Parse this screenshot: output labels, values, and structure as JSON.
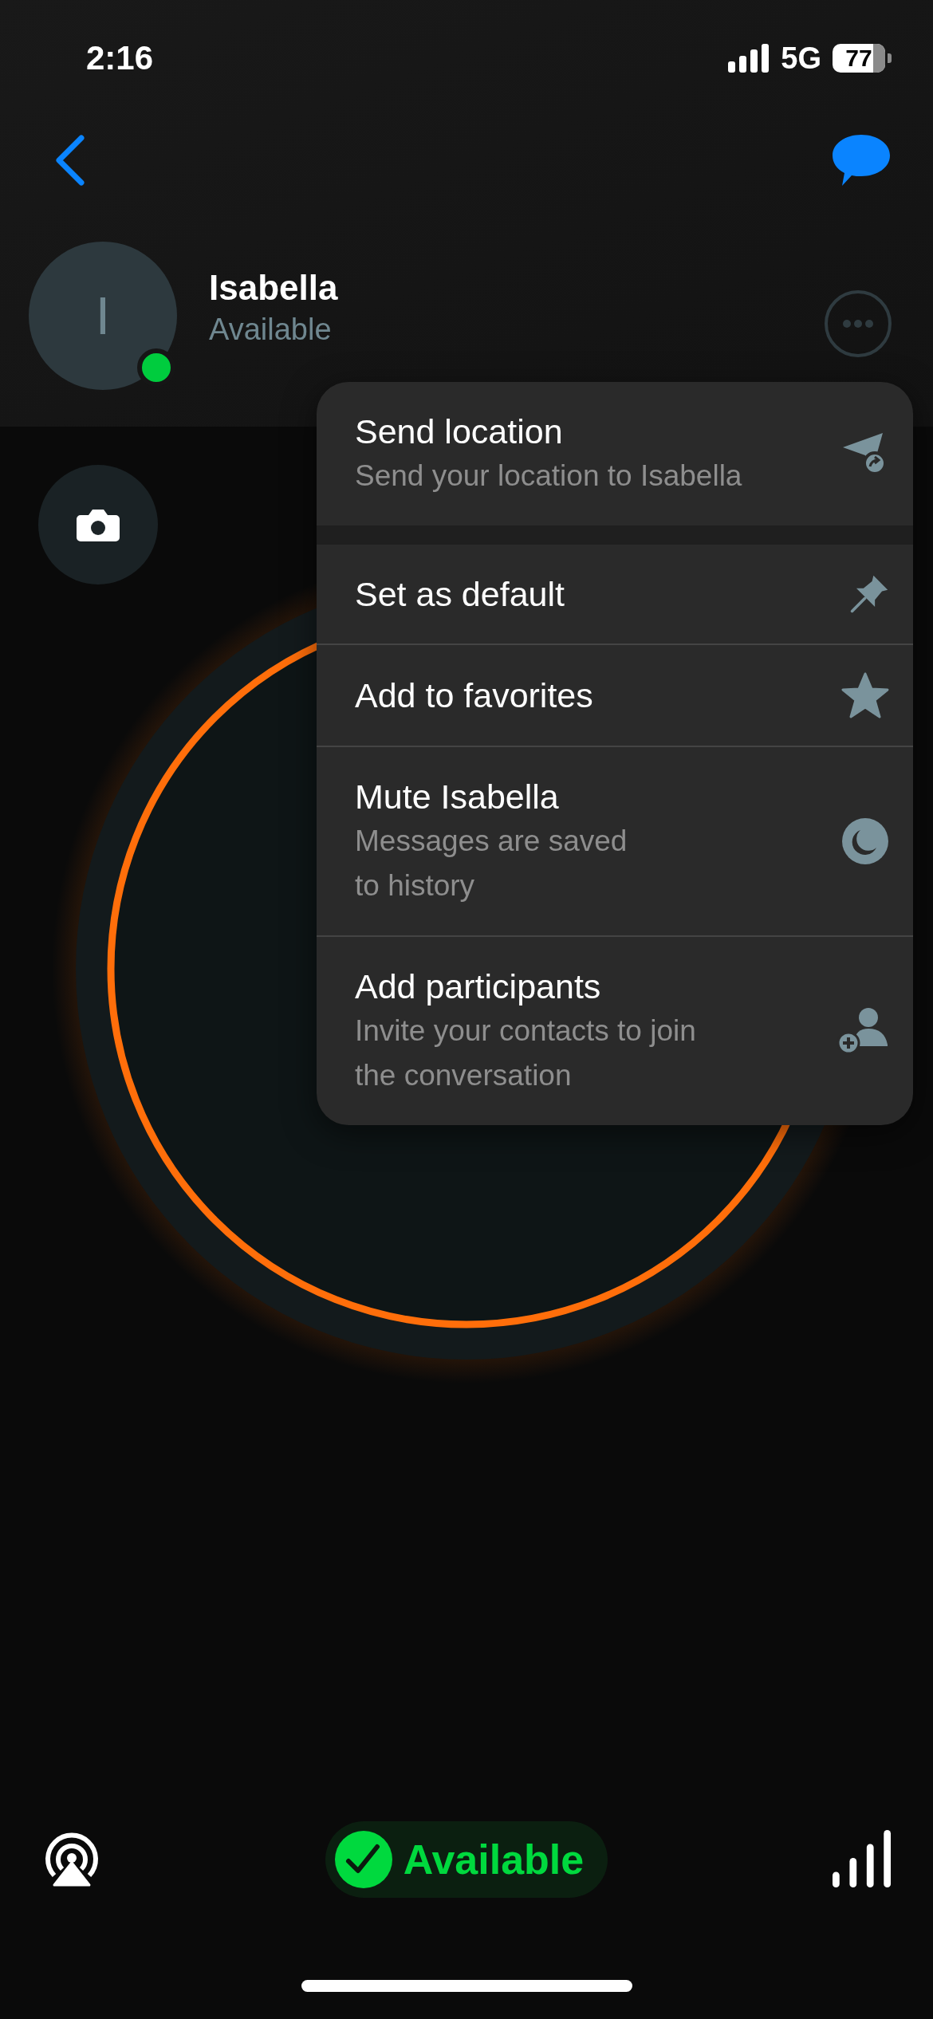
{
  "status_bar": {
    "time": "2:16",
    "network": "5G",
    "battery": "77"
  },
  "contact": {
    "initial": "I",
    "name": "Isabella",
    "status": "Available",
    "online": true
  },
  "menu": {
    "sections": [
      [
        {
          "kind": "location",
          "title": "Send location",
          "subtitle": "Send your location to Isabella"
        }
      ],
      [
        {
          "kind": "pin",
          "title": "Set as default"
        },
        {
          "kind": "star",
          "title": "Add to favorites"
        },
        {
          "kind": "moon",
          "title": "Mute Isabella",
          "subtitle": "Messages are saved\nto history"
        },
        {
          "kind": "add-person",
          "title": "Add participants",
          "subtitle": "Invite your contacts to join\nthe conversation"
        }
      ]
    ]
  },
  "presence": {
    "label": "Available"
  }
}
